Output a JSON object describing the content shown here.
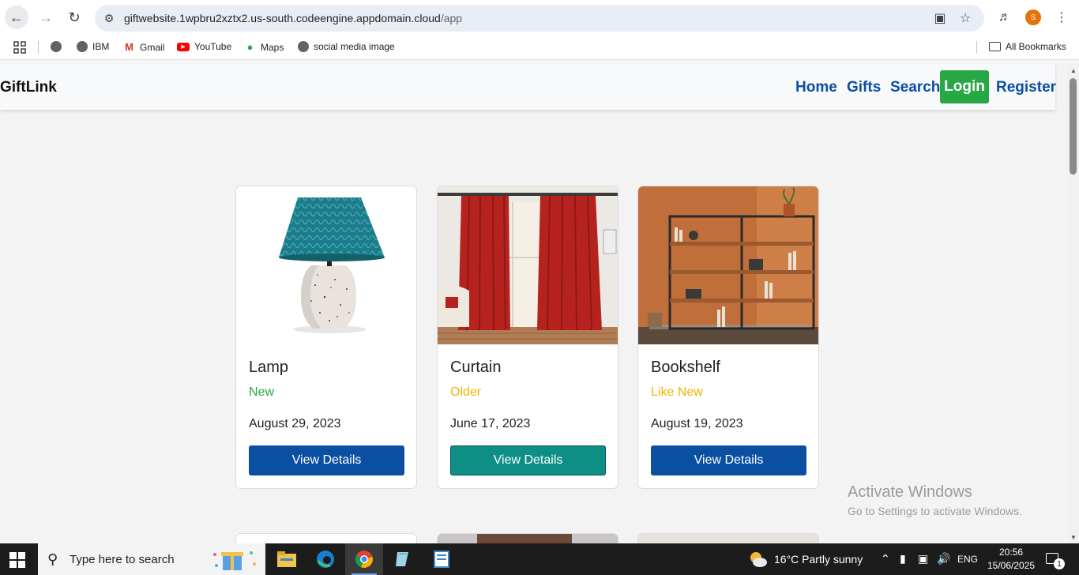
{
  "browser": {
    "url_host": "giftwebsite.1wpbru2xztx2.us-south.codeengine.appdomain.cloud",
    "url_path": "/app",
    "profile_initial": "S",
    "bookmarks": [
      {
        "label": "",
        "icon": "globe-icon"
      },
      {
        "label": "IBM",
        "icon": "globe-icon"
      },
      {
        "label": "Gmail",
        "icon": "gmail-icon"
      },
      {
        "label": "YouTube",
        "icon": "youtube-icon"
      },
      {
        "label": "Maps",
        "icon": "maps-icon"
      },
      {
        "label": "social media image",
        "icon": "globe-icon"
      }
    ],
    "all_bookmarks_label": "All Bookmarks"
  },
  "app": {
    "brand": "GiftLink",
    "nav": {
      "home": "Home",
      "gifts": "Gifts",
      "search": "Search",
      "login": "Login",
      "register": "Register"
    },
    "gifts": [
      {
        "name": "Lamp",
        "condition": "New",
        "condition_color": "#28a745",
        "date": "August 29, 2023",
        "button": "View Details",
        "button_color": "#0b4fa3"
      },
      {
        "name": "Curtain",
        "condition": "Older",
        "condition_color": "#f0b400",
        "date": "June 17, 2023",
        "button": "View Details",
        "button_color": "#0d8f86"
      },
      {
        "name": "Bookshelf",
        "condition": "Like New",
        "condition_color": "#f0b400",
        "date": "August 19, 2023",
        "button": "View Details",
        "button_color": "#0b4fa3"
      }
    ]
  },
  "watermark": {
    "line1": "Activate Windows",
    "line2": "Go to Settings to activate Windows."
  },
  "taskbar": {
    "search_placeholder": "Type here to search",
    "weather": "16°C  Partly sunny",
    "language": "ENG",
    "time": "20:56",
    "date": "15/06/2025",
    "notification_count": "1"
  }
}
